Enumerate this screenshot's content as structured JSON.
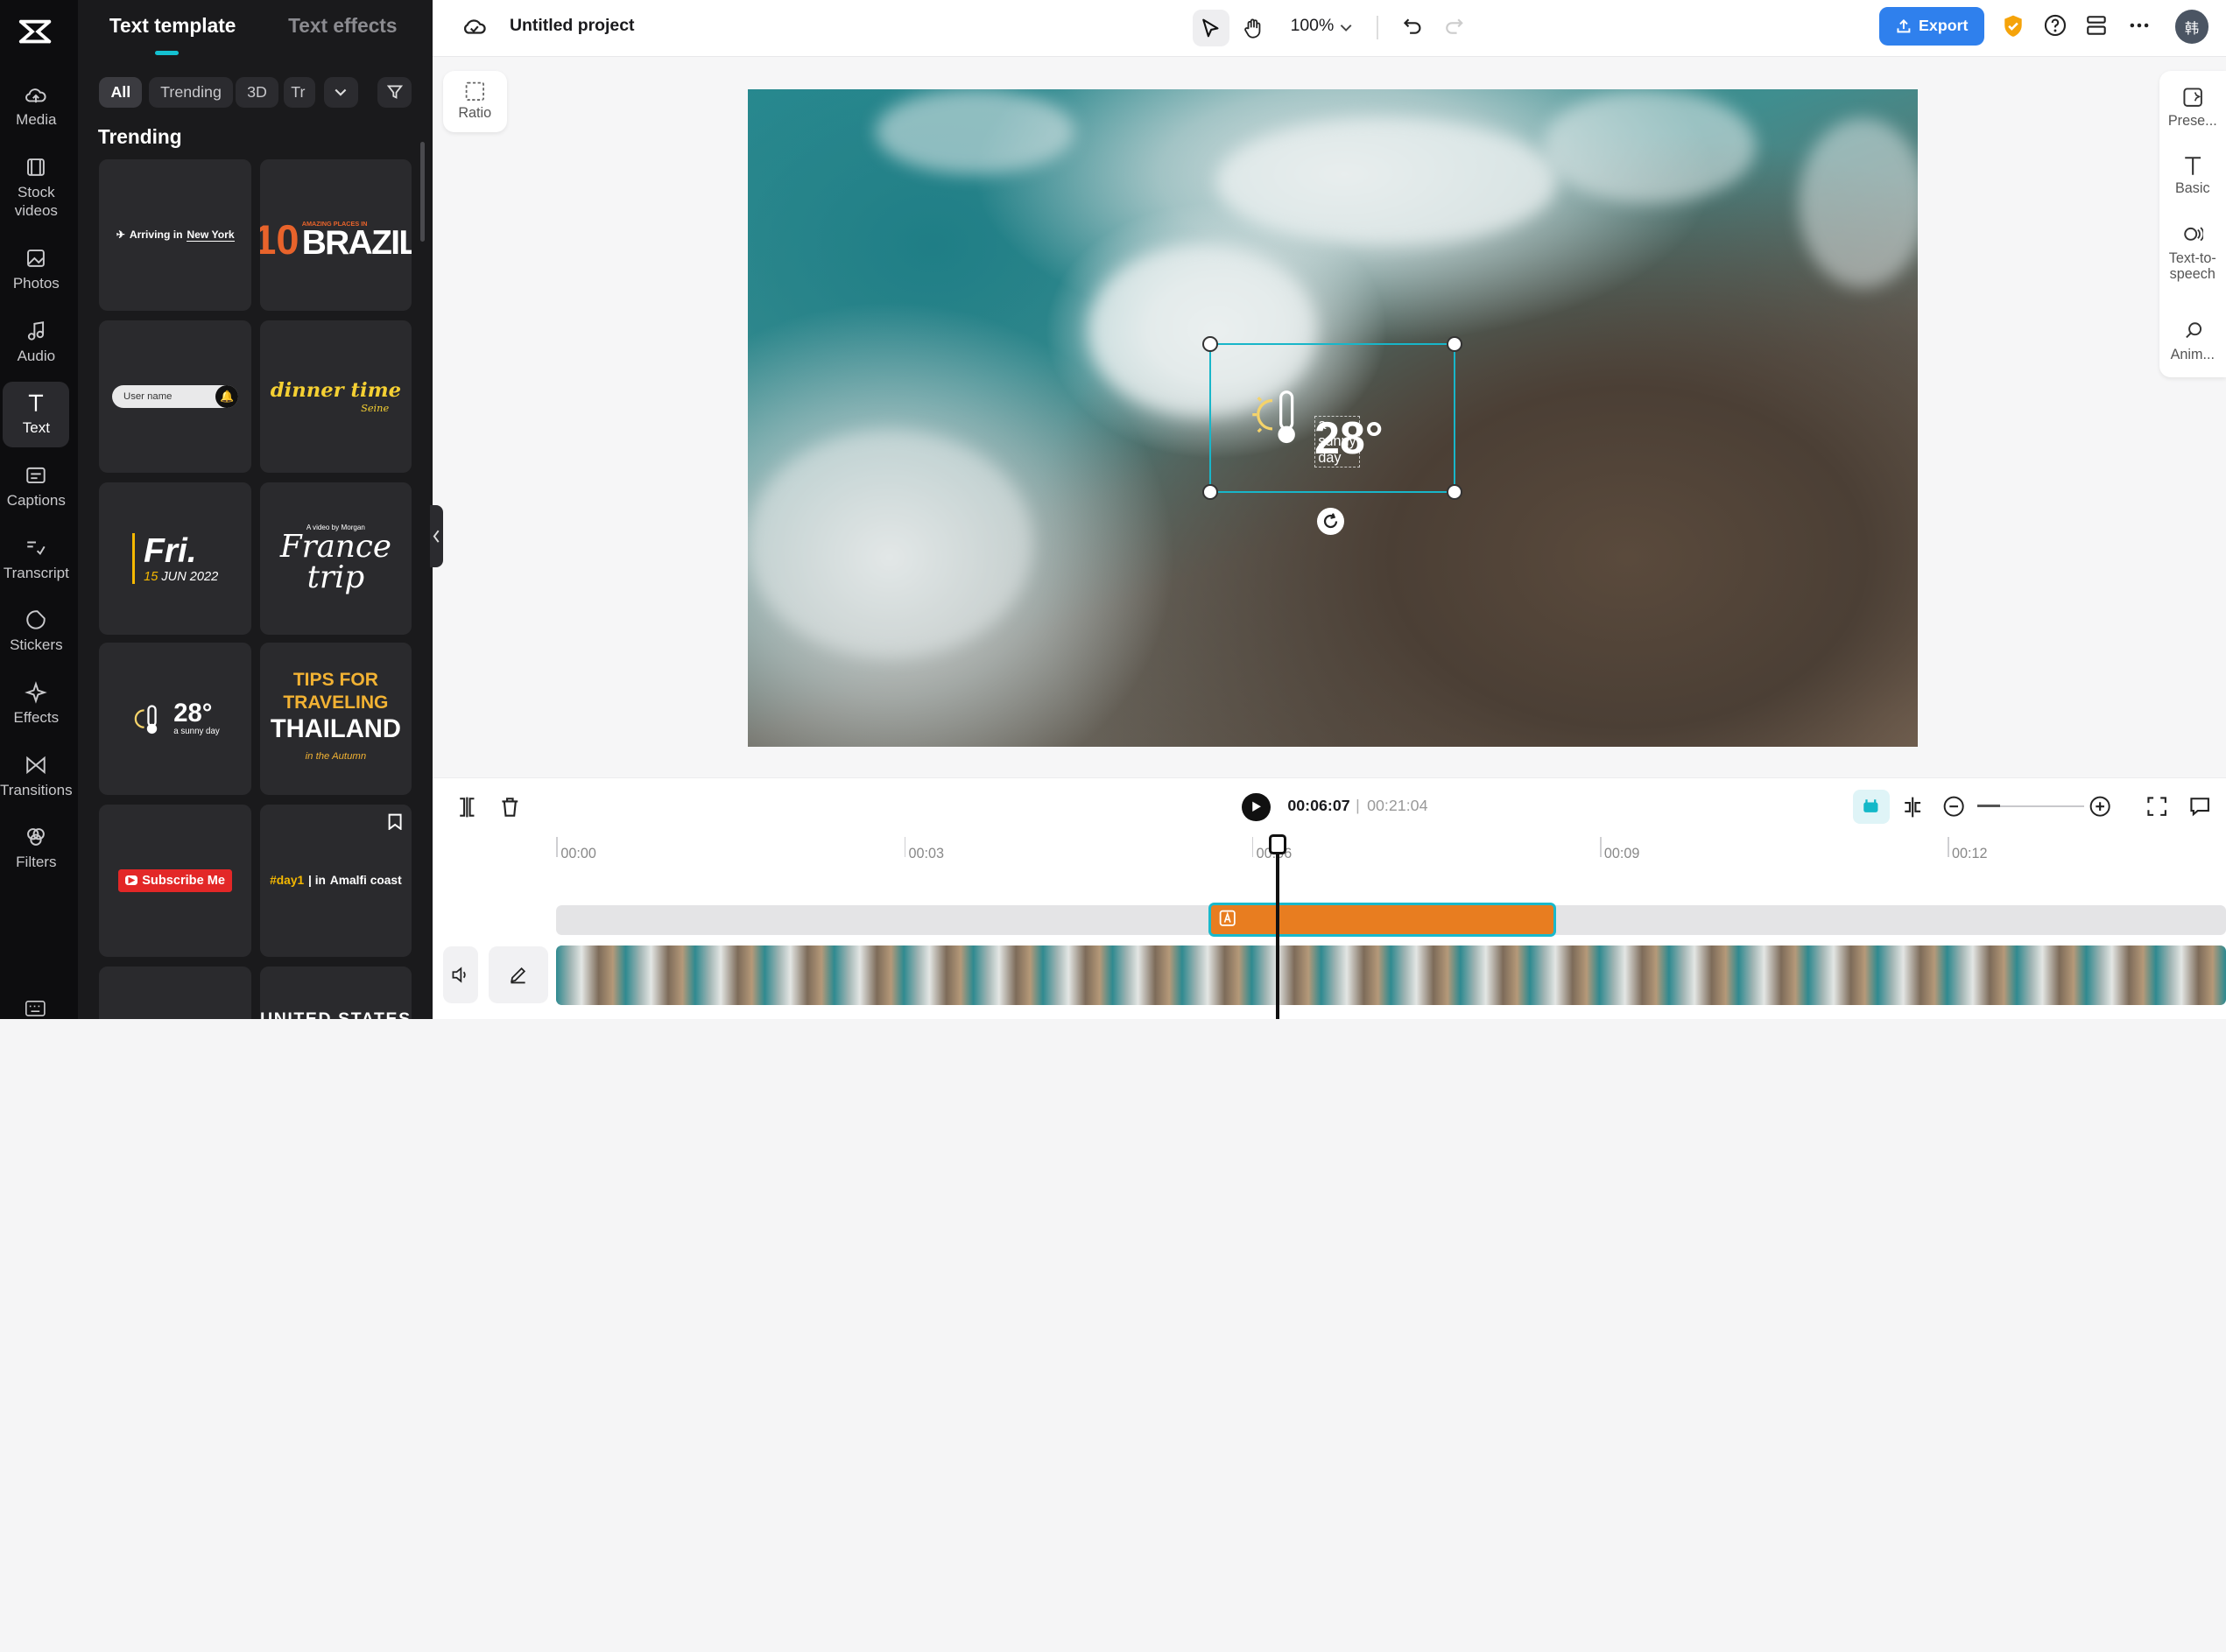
{
  "app": {
    "project_title": "Untitled project",
    "zoom": "100%",
    "export_label": "Export",
    "avatar_initial": "韩"
  },
  "rail": [
    {
      "label": "Media",
      "icon": "cloud-upload-icon"
    },
    {
      "label": "Stock videos",
      "icon": "film-icon"
    },
    {
      "label": "Photos",
      "icon": "image-icon"
    },
    {
      "label": "Audio",
      "icon": "music-note-icon"
    },
    {
      "label": "Text",
      "icon": "text-icon"
    },
    {
      "label": "Captions",
      "icon": "captions-icon"
    },
    {
      "label": "Transcript",
      "icon": "transcript-icon"
    },
    {
      "label": "Stickers",
      "icon": "sticker-icon"
    },
    {
      "label": "Effects",
      "icon": "sparkle-icon"
    },
    {
      "label": "Transitions",
      "icon": "transition-icon"
    },
    {
      "label": "Filters",
      "icon": "filter-icon"
    }
  ],
  "panel": {
    "tabs": [
      "Text template",
      "Text effects"
    ],
    "chips": [
      "All",
      "Trending",
      "3D",
      "Tr"
    ],
    "section": "Trending",
    "cards": [
      {
        "line1": "Arriving in",
        "line2": "New York"
      },
      {
        "line1": "10",
        "line2": "BRAZIL",
        "small": "AMAZING PLACES IN"
      },
      {
        "line1": "User name"
      },
      {
        "line1": "dinner time",
        "line2": "Seine"
      },
      {
        "line1": "Fri.",
        "line2": "15",
        "line3": "JUN 2022"
      },
      {
        "line0": "A video by Morgan",
        "line1": "France",
        "line2": "trip"
      },
      {
        "line1": "28°",
        "line2": "a sunny day"
      },
      {
        "line1": "TIPS FOR",
        "line2": "TRAVELING",
        "line3": "THAILAND",
        "line4": "in the Autumn"
      },
      {
        "line1": "Subscribe Me"
      },
      {
        "line1": "#day1",
        "line2": "| in",
        "line3": "Amalfi coast"
      },
      {},
      {
        "line1": "UNITED STATES"
      }
    ]
  },
  "canvas": {
    "ratio_label": "Ratio",
    "weather": {
      "temp": "28°",
      "caption": "a sunny day"
    }
  },
  "right_rail": [
    {
      "label": "Prese...",
      "icon": "preset-icon"
    },
    {
      "label": "Basic",
      "icon": "text-basic-icon"
    },
    {
      "label": "Text-to-speech",
      "icon": "speech-icon"
    },
    {
      "label": "Anim...",
      "icon": "animation-icon"
    }
  ],
  "timeline": {
    "current_time": "00:06:07",
    "separator": "|",
    "total_time": "00:21:04",
    "ruler": [
      "00:00",
      "00:03",
      "00:06",
      "00:09",
      "00:12"
    ]
  },
  "colors": {
    "accent": "#14c1d1",
    "export": "#2f80ed",
    "clip": "#e87d20"
  }
}
